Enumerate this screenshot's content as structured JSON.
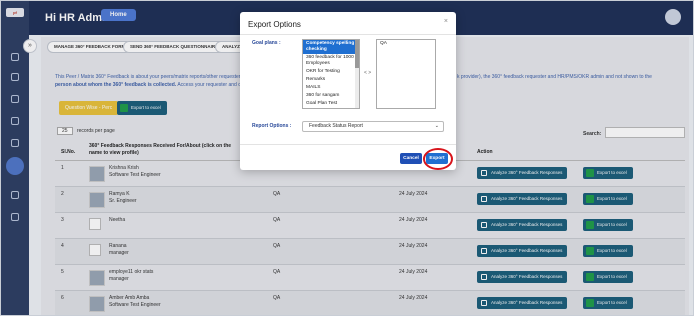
{
  "app": {
    "title": "Hi HR Admin",
    "home_label": "Home",
    "logo_text": "pf"
  },
  "tabs": [
    "MANAGE 360° FEEDBACK FORM",
    "SEND 360° FEEDBACK QUESTIONNAIRE",
    "ANALYZE"
  ],
  "notice": {
    "line1a": "This Peer / Matrix 360° Feedback is about your peers/matrix reports/other requester",
    "line1b": "k provider), the 360° feedback requester and HR/PMS/OKR admin and not shown to the",
    "line2": "person about whom the 360° feedback is collected.",
    "line2b": "Access your requester and colle"
  },
  "buttons": {
    "question_wise": "Question Wise - Perc",
    "export_excel": "Export to excel",
    "analyze": "Analyze 360° Feedback Responses",
    "export_small": "Export to excel"
  },
  "records": {
    "count": "25",
    "label": "records per page"
  },
  "search_label": "Search:",
  "table": {
    "headers": [
      "Sl.No.",
      "360° Feedback Responses Received For/About (click on the name to view profile)",
      "",
      "",
      "Action"
    ],
    "rows": [
      {
        "sl": "1",
        "name": "Krishna Krish",
        "title": "Software Test Engineer",
        "plan": "",
        "date": "",
        "photo": true
      },
      {
        "sl": "2",
        "name": "Ramya K",
        "title": "Sr. Engineer",
        "plan": "QA",
        "date": "24 July 2024",
        "photo": true
      },
      {
        "sl": "3",
        "name": "Neetha",
        "title": "",
        "plan": "QA",
        "date": "24 July 2024",
        "photo": false
      },
      {
        "sl": "4",
        "name": "Ranana",
        "title": "manager",
        "plan": "QA",
        "date": "24 July 2024",
        "photo": false
      },
      {
        "sl": "5",
        "name": "employe11 okr stats",
        "title": "manager",
        "plan": "QA",
        "date": "24 July 2024",
        "photo": true
      },
      {
        "sl": "6",
        "name": "Amber Amb Amba",
        "title": "Software Test Engineer",
        "plan": "QA",
        "date": "24 July 2024",
        "photo": true
      }
    ]
  },
  "modal": {
    "title": "Export Options",
    "close": "×",
    "goal_plans_label": "Goal plans :",
    "goal_plans": [
      "Competency spelling checking",
      "360 feedback for 1000 Employees",
      "OKR for Testing",
      "Remarks",
      "MAILS",
      "360 for sangam",
      "Goal Plan Test"
    ],
    "selected_plans": [
      "QA"
    ],
    "arrows": "< >",
    "report_label": "Report Options :",
    "report_value": "Feedback Status Report",
    "cancel": "Cancel",
    "export": "Export"
  },
  "colors": {
    "header": "#1e2f56",
    "sidebar": "#2d3e63",
    "accent": "#1f6fd1",
    "highlight": "#d8141b"
  }
}
